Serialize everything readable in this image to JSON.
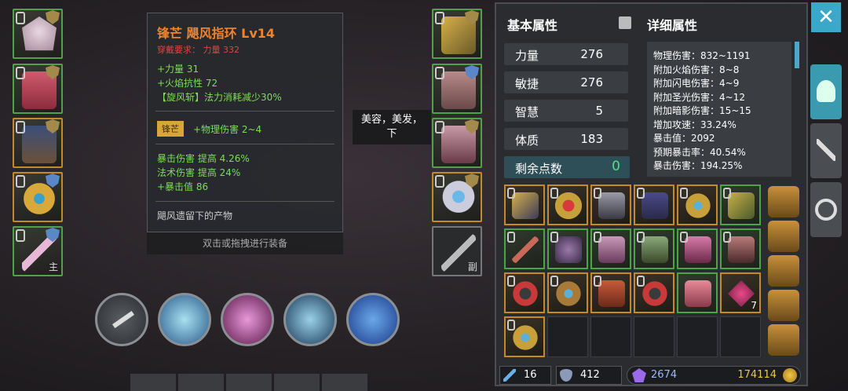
{
  "tooltip": {
    "title": "锋芒 飓风指环 Lv14",
    "requirement": "穿戴要求：   力量 332",
    "base_stats": [
      "+力量 31",
      "+火焰抗性 72",
      "【旋风斩】法力消耗减少30%"
    ],
    "affix_badge": "锋芒",
    "affix_stat": "+物理伤害 2~4",
    "extra_stats": [
      "暴击伤害 提高 4.26%",
      "法术伤害 提高 24%",
      "+暴击值 86"
    ],
    "description": "飓风遗留下的产物"
  },
  "hint": "双击或拖拽进行装备",
  "bubble": {
    "line1": "美容，美发，",
    "line2": "下"
  },
  "left_slot_tag": "主",
  "right_slot_tag": "副",
  "panel": {
    "basic_title": "基本属性",
    "detail_title": "详细属性",
    "stats": [
      {
        "name": "力量",
        "value": "276"
      },
      {
        "name": "敏捷",
        "value": "276"
      },
      {
        "name": "智慧",
        "value": "5"
      },
      {
        "name": "体质",
        "value": "183"
      }
    ],
    "remaining_label": "剩余点数",
    "remaining_value": "0",
    "details": [
      "物理伤害：832~1191",
      "附加火焰伤害：8~8",
      "附加闪电伤害：4~9",
      "附加圣光伤害：4~12",
      "附加暗影伤害：15~15",
      "增加攻速：33.24%",
      "暴击值：2092",
      "预期暴击率：40.54%",
      "暴击伤害：194.25%"
    ]
  },
  "bag": {
    "stack_count": "7"
  },
  "footer": {
    "swords": "16",
    "shields": "412",
    "gems": "2674",
    "gold": "174114"
  },
  "colors": {
    "accent_orange": "#f0832c",
    "accent_green": "#7edd58",
    "rarity_green": "#4fa24a",
    "rarity_orange": "#c38a2a"
  }
}
